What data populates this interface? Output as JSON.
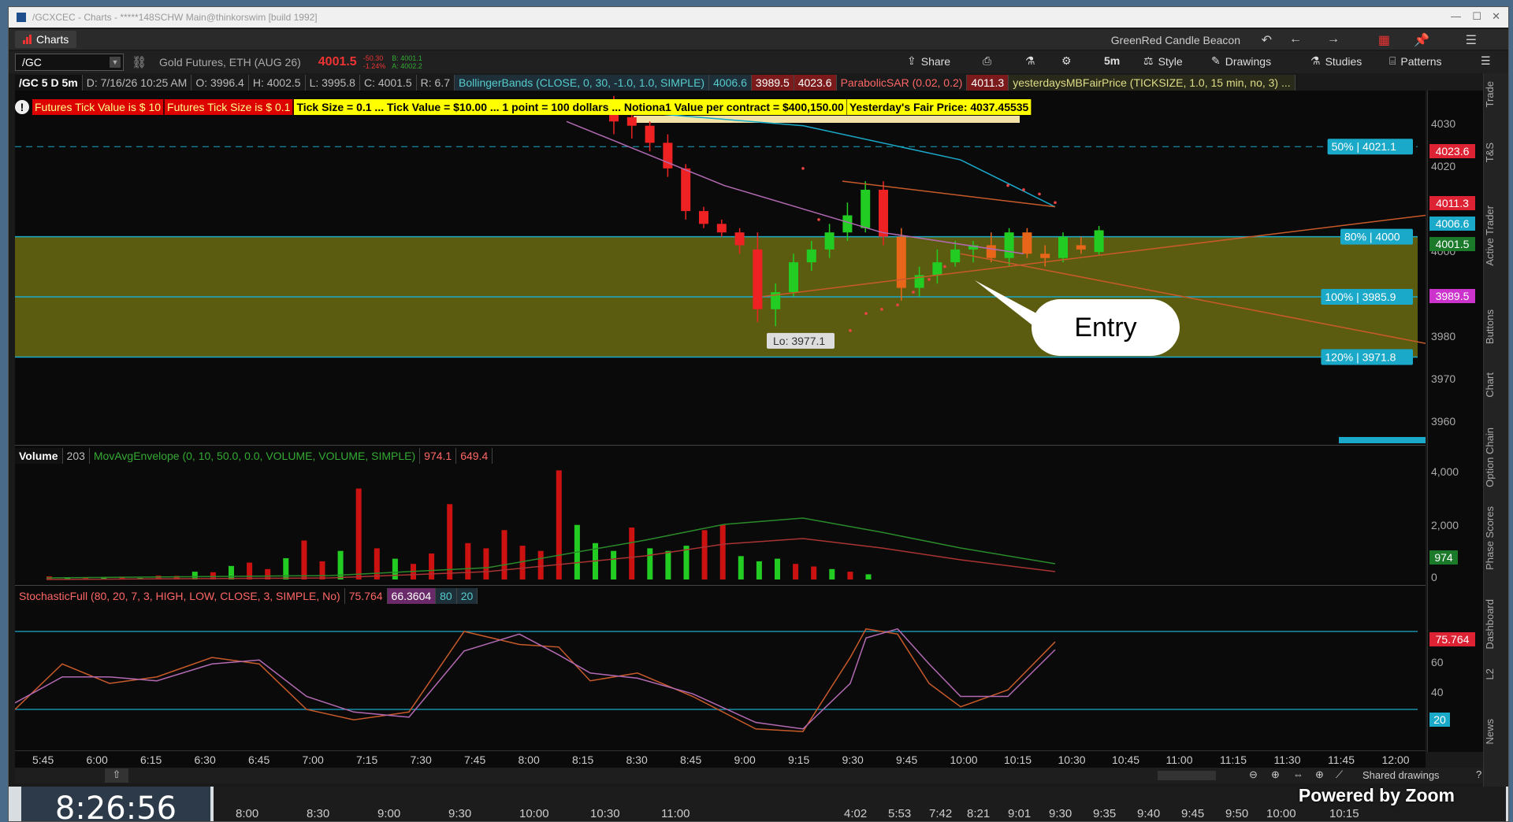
{
  "window": {
    "title": "/GCXCEC - Charts - *****148SCHW Main@thinkorswim [build 1992]"
  },
  "menubar": {
    "charts_tab": "Charts",
    "beacon": "GreenRed Candle Beacon"
  },
  "toolbar": {
    "symbol": "/GC",
    "instrument": "Gold Futures, ETH (AUG 26)",
    "last_price": "4001.5",
    "net_change": "-50.30",
    "pct_change": "-1.24%",
    "bid": "B: 4001.1",
    "ask": "A: 4002.2",
    "share": "Share",
    "timeframe": "5m",
    "style": "Style",
    "drawings": "Drawings",
    "studies": "Studies",
    "patterns": "Patterns"
  },
  "study_line": {
    "chart_id": "/GC 5 D 5m",
    "date": "D: 7/16/26 10:25 AM",
    "open": "O: 3996.4",
    "high": "H: 4002.5",
    "low": "L: 3995.8",
    "close": "C: 4001.5",
    "range": "R: 6.7",
    "bollinger": "BollingerBands (CLOSE, 0, 30, -1.0, 1.0, SIMPLE)",
    "bb1": "4006.6",
    "bb2": "3989.5",
    "bb3": "4023.6",
    "psar": "ParabolicSAR (0.02, 0.2)",
    "psar_val": "4011.3",
    "fair": "yesterdaysMBFairPrice (TICKSIZE, 1.0, 15 min, no, 3) ..."
  },
  "alerts": {
    "a1": "Futures Tick Value is $ 10",
    "a2": "Futures Tick Size is $ 0.1",
    "a3": "Tick Size = 0.1 ... Tick Value = $10.00 ... 1 point = 100 dollars ... Notiona1 Value per contract = $400,150.00",
    "a4": "Yesterday's Fair Price: 4037.45535"
  },
  "levels": {
    "l50": "50% | 4021.1",
    "l80": "80% | 4000",
    "l100": "100% | 3985.9",
    "l120": "120% | 3971.8"
  },
  "price_badges": {
    "bb_upper": "4023.6",
    "psar": "4011.3",
    "bb_mid": "4006.6",
    "last": "4001.5",
    "bb_lower": "3989.5"
  },
  "price_axis": [
    "4030",
    "4020",
    "4000",
    "3980",
    "3970",
    "3960"
  ],
  "low_label": "Lo: 3977.1",
  "callout": "Entry",
  "volume": {
    "label": "Volume",
    "value": "203",
    "env": "MovAvgEnvelope (0, 10, 50.0, 0.0, VOLUME, VOLUME, SIMPLE)",
    "env1": "974.1",
    "env2": "649.4",
    "axis": [
      "4,000",
      "2,000",
      "0"
    ],
    "badge": "974"
  },
  "stoch": {
    "label": "StochasticFull (80, 20, 7, 3, HIGH, LOW, CLOSE, 3, SIMPLE, No)",
    "k": "75.764",
    "d": "66.3604",
    "ob": "80",
    "os": "20",
    "axis": [
      "60",
      "40"
    ],
    "badge_k": "75.764",
    "badge_os": "20"
  },
  "time_axis": [
    "5:45",
    "6:00",
    "6:15",
    "6:30",
    "6:45",
    "7:00",
    "7:15",
    "7:30",
    "7:45",
    "8:00",
    "8:15",
    "8:30",
    "8:45",
    "9:00",
    "9:15",
    "9:30",
    "9:45",
    "10:00",
    "10:15",
    "10:30",
    "10:45",
    "11:00",
    "11:15",
    "11:30",
    "11:45",
    "12:00"
  ],
  "bottombar": {
    "shared": "Shared drawings"
  },
  "side_tabs": [
    "Trade",
    "T&S",
    "Active Trader",
    "Buttons",
    "Chart",
    "Option Chain",
    "Phase Scores",
    "Dashboard",
    "L2",
    "News"
  ],
  "zoom": {
    "clock": "8:26:56",
    "brand": "Powered by Zoom",
    "times_a": [
      "8:00",
      "8:30",
      "9:00",
      "9:30",
      "10:00",
      "10:30",
      "11:00"
    ],
    "times_b": [
      "4:02",
      "5:53",
      "7:42",
      "8:21",
      "9:01",
      "9:30",
      "9:35",
      "9:40",
      "9:45",
      "9:50",
      "10:00",
      "10:15"
    ]
  },
  "colors": {
    "up": "#22cc22",
    "down": "#ee2222",
    "zone": "#6b6b12",
    "accent": "#1aa9c8"
  }
}
